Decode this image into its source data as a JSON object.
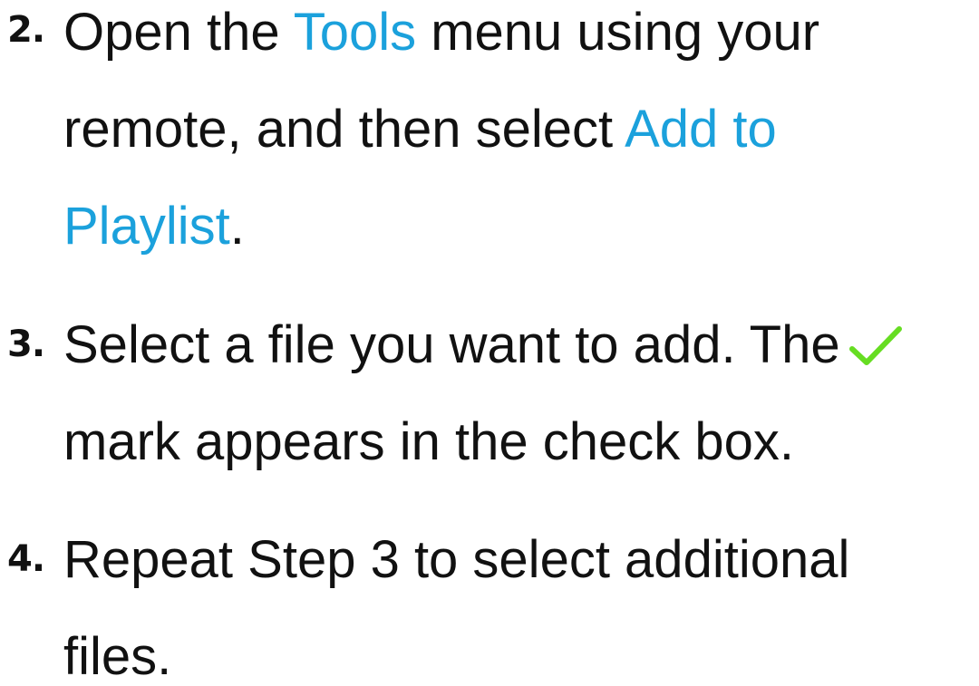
{
  "steps": [
    {
      "number": "2.",
      "line1_a": "Open the ",
      "line1_b": "Tools",
      "line1_c": " menu using your",
      "line2_a": "remote, and then select ",
      "line2_b": "Add to",
      "line3_a": "Playlist",
      "line3_b": "."
    },
    {
      "number": "3.",
      "line1_a": "Select a file you want to add. The",
      "line2_a": "mark appears in the check box."
    },
    {
      "number": "4.",
      "line1_a": "Repeat Step 3 to select additional",
      "line2_a": "files."
    }
  ],
  "colors": {
    "highlight": "#1ba1dc",
    "check": "#66dd22",
    "text": "#111111"
  },
  "icons": {
    "checkmark": "check-icon"
  }
}
